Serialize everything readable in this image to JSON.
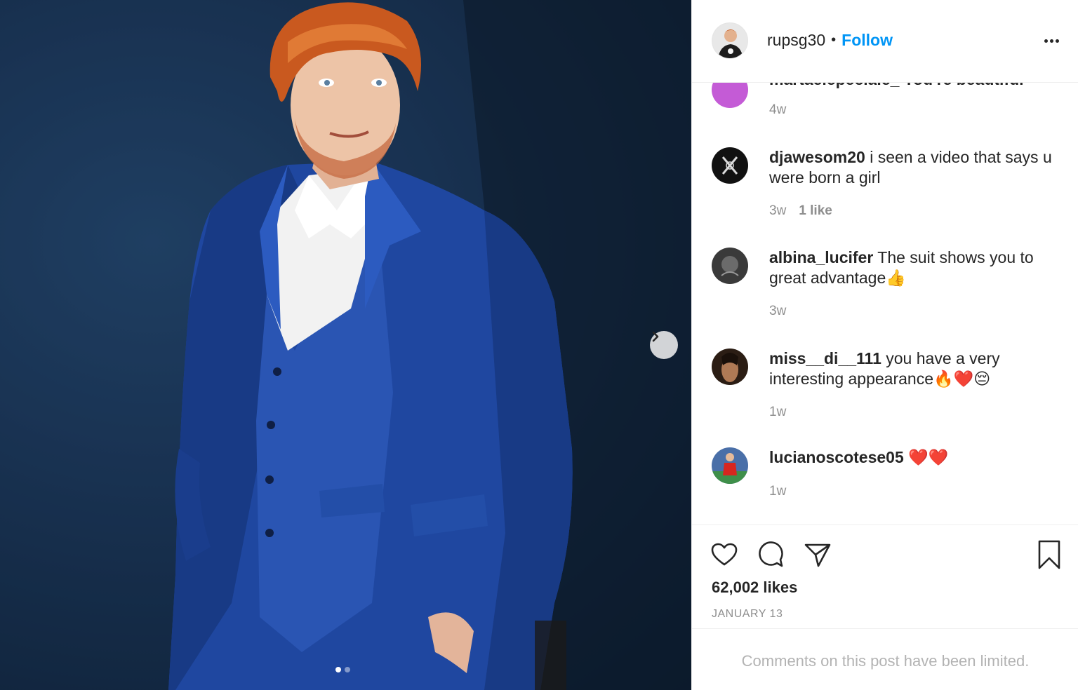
{
  "header": {
    "username": "rupsg30",
    "separator": "•",
    "follow_label": "Follow"
  },
  "comments": {
    "partial": {
      "text": "martaelepeciale_ You're beautiful",
      "time": "4w"
    },
    "items": [
      {
        "username": "djawesom20",
        "text": "i seen a video that says u were born a girl",
        "time": "3w",
        "likes": "1 like"
      },
      {
        "username": "albina_lucifer",
        "text": "The suit shows you to great advantage",
        "emoji": "👍",
        "time": "3w"
      },
      {
        "username": "miss__di__111",
        "text": "you have a very interesting appearance",
        "emoji": "🔥❤️😔",
        "time": "1w"
      },
      {
        "username": "lucianoscotese05",
        "text": "",
        "emoji": "❤️❤️",
        "time": "1w"
      }
    ]
  },
  "actions": {
    "icons": [
      "heart-icon",
      "comment-bubble-icon",
      "share-paper-plane-icon",
      "bookmark-icon"
    ]
  },
  "likes_label": "62,002 likes",
  "date_label": "JANUARY 13",
  "comments_limited_label": "Comments on this post have been limited.",
  "carousel": {
    "current": 1,
    "total": 2
  },
  "colors": {
    "accent": "#0095f6",
    "muted": "#8e8e8e",
    "text": "#262626"
  }
}
